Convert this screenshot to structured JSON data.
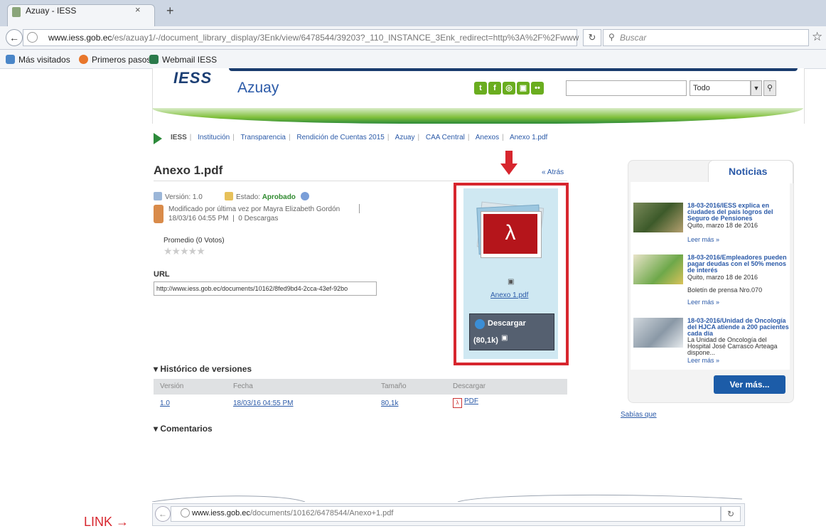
{
  "browser": {
    "tab_title": "Azuay - IESS",
    "tab_close": "×",
    "new_tab": "+",
    "url_host": "www.iess.gob.ec",
    "url_path": "/es/azuay1/-/document_library_display/3Enk/view/6478544/39203?_110_INSTANCE_3Enk_redirect=http%3A%2F%2Fwww",
    "search_placeholder": "Buscar",
    "bookmarks": [
      "Más visitados",
      "Primeros pasos",
      "Webmail IESS"
    ]
  },
  "header": {
    "logo": "IESS",
    "site_name": "Azuay",
    "social_icons": [
      "twitter-icon",
      "facebook-icon",
      "rss-icon",
      "youtube-icon",
      "flickr-icon"
    ],
    "social_glyphs": [
      "t",
      "f",
      "◎",
      "▣",
      "••"
    ],
    "select_value": "Todo",
    "brand_color": "#1c3f74",
    "accent_color": "#6aad1f"
  },
  "breadcrumb": [
    "IESS",
    "Institución",
    "Transparencia",
    "Rendición de Cuentas 2015",
    "Azuay",
    "CAA Central",
    "Anexos",
    "Anexo 1.pdf"
  ],
  "document": {
    "title": "Anexo 1.pdf",
    "back": "« Atrás",
    "version_label": "Versión:",
    "version": "1.0",
    "status_label": "Estado:",
    "status": "Aprobado",
    "modified_by": "Modificado por última vez por Mayra Elizabeth Gordón",
    "modified_date": "18/03/16 04:55 PM",
    "downloads": "0 Descargas",
    "average": "Promedio (0 Votos)",
    "stars": "★★★★★",
    "url_label": "URL",
    "url_value": "http://www.iess.gob.ec/documents/10162/8fed9bd4-2cca-43ef-92bo",
    "preview_file": "Anexo 1.pdf",
    "download_label": "Descargar",
    "download_size": "(80,1k)"
  },
  "versions": {
    "title": "▾ Histórico de versiones",
    "headers": [
      "Versión",
      "Fecha",
      "Tamaño",
      "Descargar"
    ],
    "row": {
      "version": "1.0",
      "date": "18/03/16 04:55 PM",
      "size": "80,1k",
      "download": "PDF"
    },
    "comments_title": "▾ Comentarios"
  },
  "sidebar": {
    "tab": "Noticias",
    "news": [
      {
        "title": "18-03-2016/IESS explica en ciudades del país logros del Seguro de Pensiones",
        "sub": "Quito, marzo 18 de 2016",
        "more": "Leer más »"
      },
      {
        "title": "18-03-2016/Empleadores pueden pagar deudas con el 50% menos de interés",
        "sub": "Quito, marzo 18 de 2016",
        "extra": "Boletín de prensa Nro.070",
        "more": "Leer más »"
      },
      {
        "title": "18-03-2016/Unidad de Oncología del HJCA atiende a 200 pacientes cada día",
        "sub": "La Unidad de Oncología del Hospital José Carrasco Arteaga dispone...",
        "more": "Leer más »"
      }
    ],
    "more_button": "Ver más...",
    "sabias": "Sabías que"
  },
  "annotation": {
    "link_label": "LINK →",
    "color": "#d7262e"
  },
  "inset": {
    "url_host": "www.iess.gob.ec",
    "url_path": "/documents/10162/6478544/Anexo+1.pdf"
  }
}
